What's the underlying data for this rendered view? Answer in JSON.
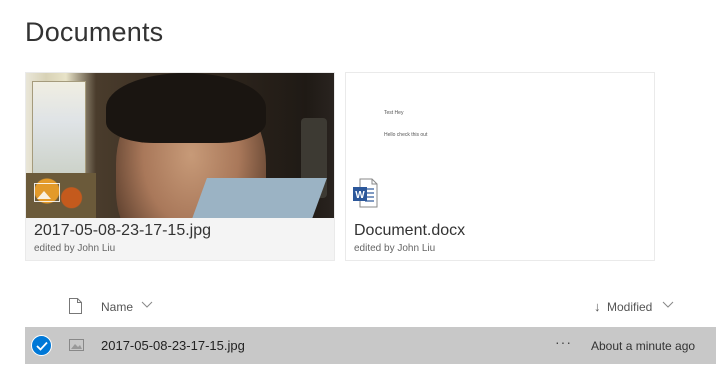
{
  "library": {
    "title": "Documents"
  },
  "tiles": [
    {
      "name": "2017-05-08-23-17-15.jpg",
      "meta": "edited by John Liu",
      "type_icon": "image-icon"
    },
    {
      "name": "Document.docx",
      "meta": "edited by John Liu",
      "type_icon": "word-icon",
      "preview_lines": [
        "Test Hey",
        "Hello check this out"
      ]
    }
  ],
  "list": {
    "columns": {
      "name": "Name",
      "modified": "Modified"
    },
    "sort": {
      "column": "modified",
      "direction": "descending"
    },
    "rows": [
      {
        "name": "2017-05-08-23-17-15.jpg",
        "modified": "About a minute ago",
        "more": "···",
        "selected": true,
        "type_icon": "image-icon"
      }
    ]
  },
  "colors": {
    "selection_check": "#0078d7",
    "selected_row": "#c8c8c8",
    "word_blue": "#2b579a"
  }
}
